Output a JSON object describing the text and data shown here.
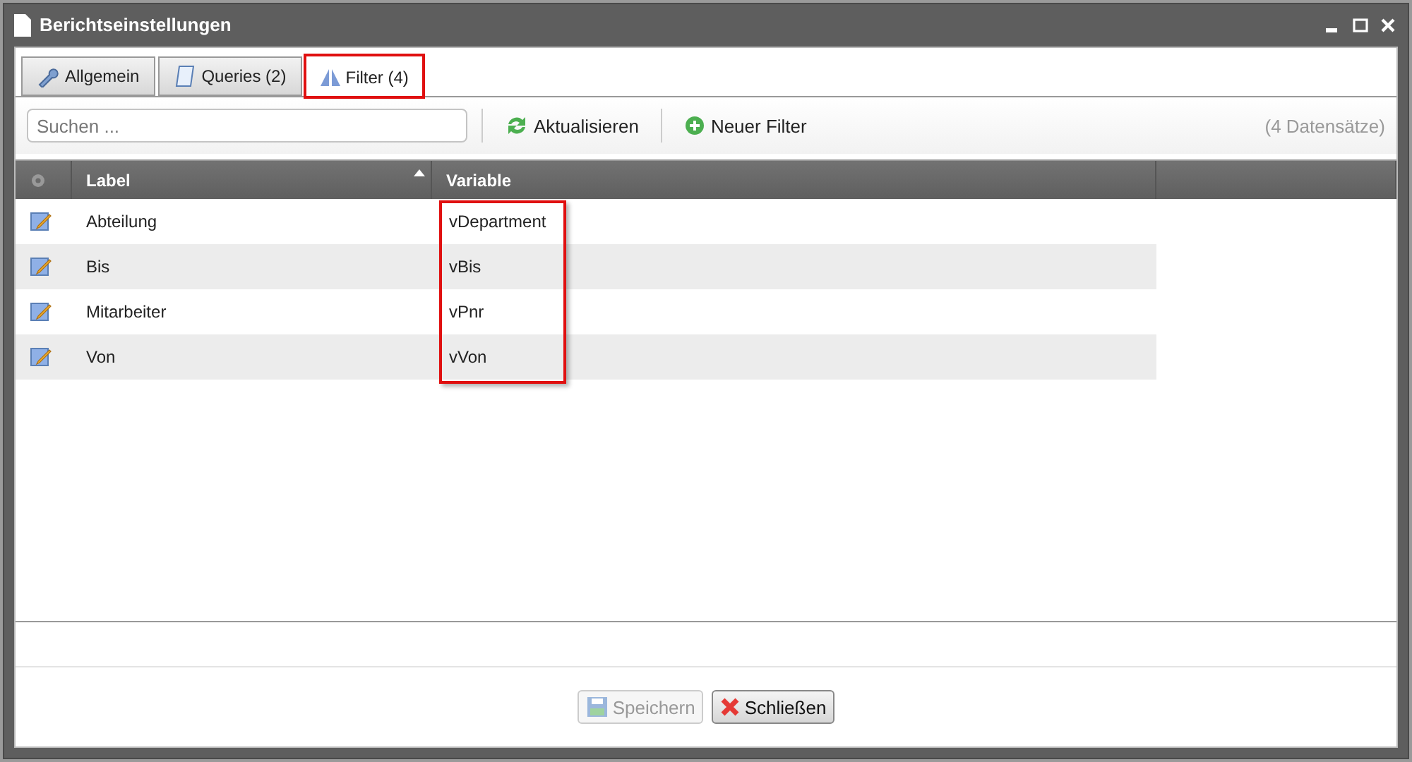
{
  "window": {
    "title": "Berichtseinstellungen"
  },
  "tabs": [
    {
      "label": "Allgemein",
      "selected": false,
      "highlighted": false
    },
    {
      "label": "Queries (2)",
      "selected": false,
      "highlighted": false
    },
    {
      "label": "Filter (4)",
      "selected": true,
      "highlighted": true
    }
  ],
  "toolbar": {
    "search": {
      "placeholder": "Suchen ..."
    },
    "buttons": [
      {
        "label": "Aktualisieren"
      },
      {
        "label": "Neuer Filter"
      }
    ],
    "count": "(4 Datensätze)"
  },
  "table": {
    "columns": [
      {
        "label": "Label",
        "sorted": true,
        "highlighted": false
      },
      {
        "label": "Variable",
        "sorted": false,
        "highlighted": true
      }
    ],
    "rows": [
      {
        "label": "Abteilung",
        "variable": "vDepartment"
      },
      {
        "label": "Bis",
        "variable": "vBis"
      },
      {
        "label": "Mitarbeiter",
        "variable": "vPnr"
      },
      {
        "label": "Von",
        "variable": "vVon"
      }
    ]
  },
  "footer": {
    "buttons": [
      {
        "label": "Speichern",
        "disabled": true
      },
      {
        "label": "Schließen",
        "disabled": false
      }
    ]
  }
}
